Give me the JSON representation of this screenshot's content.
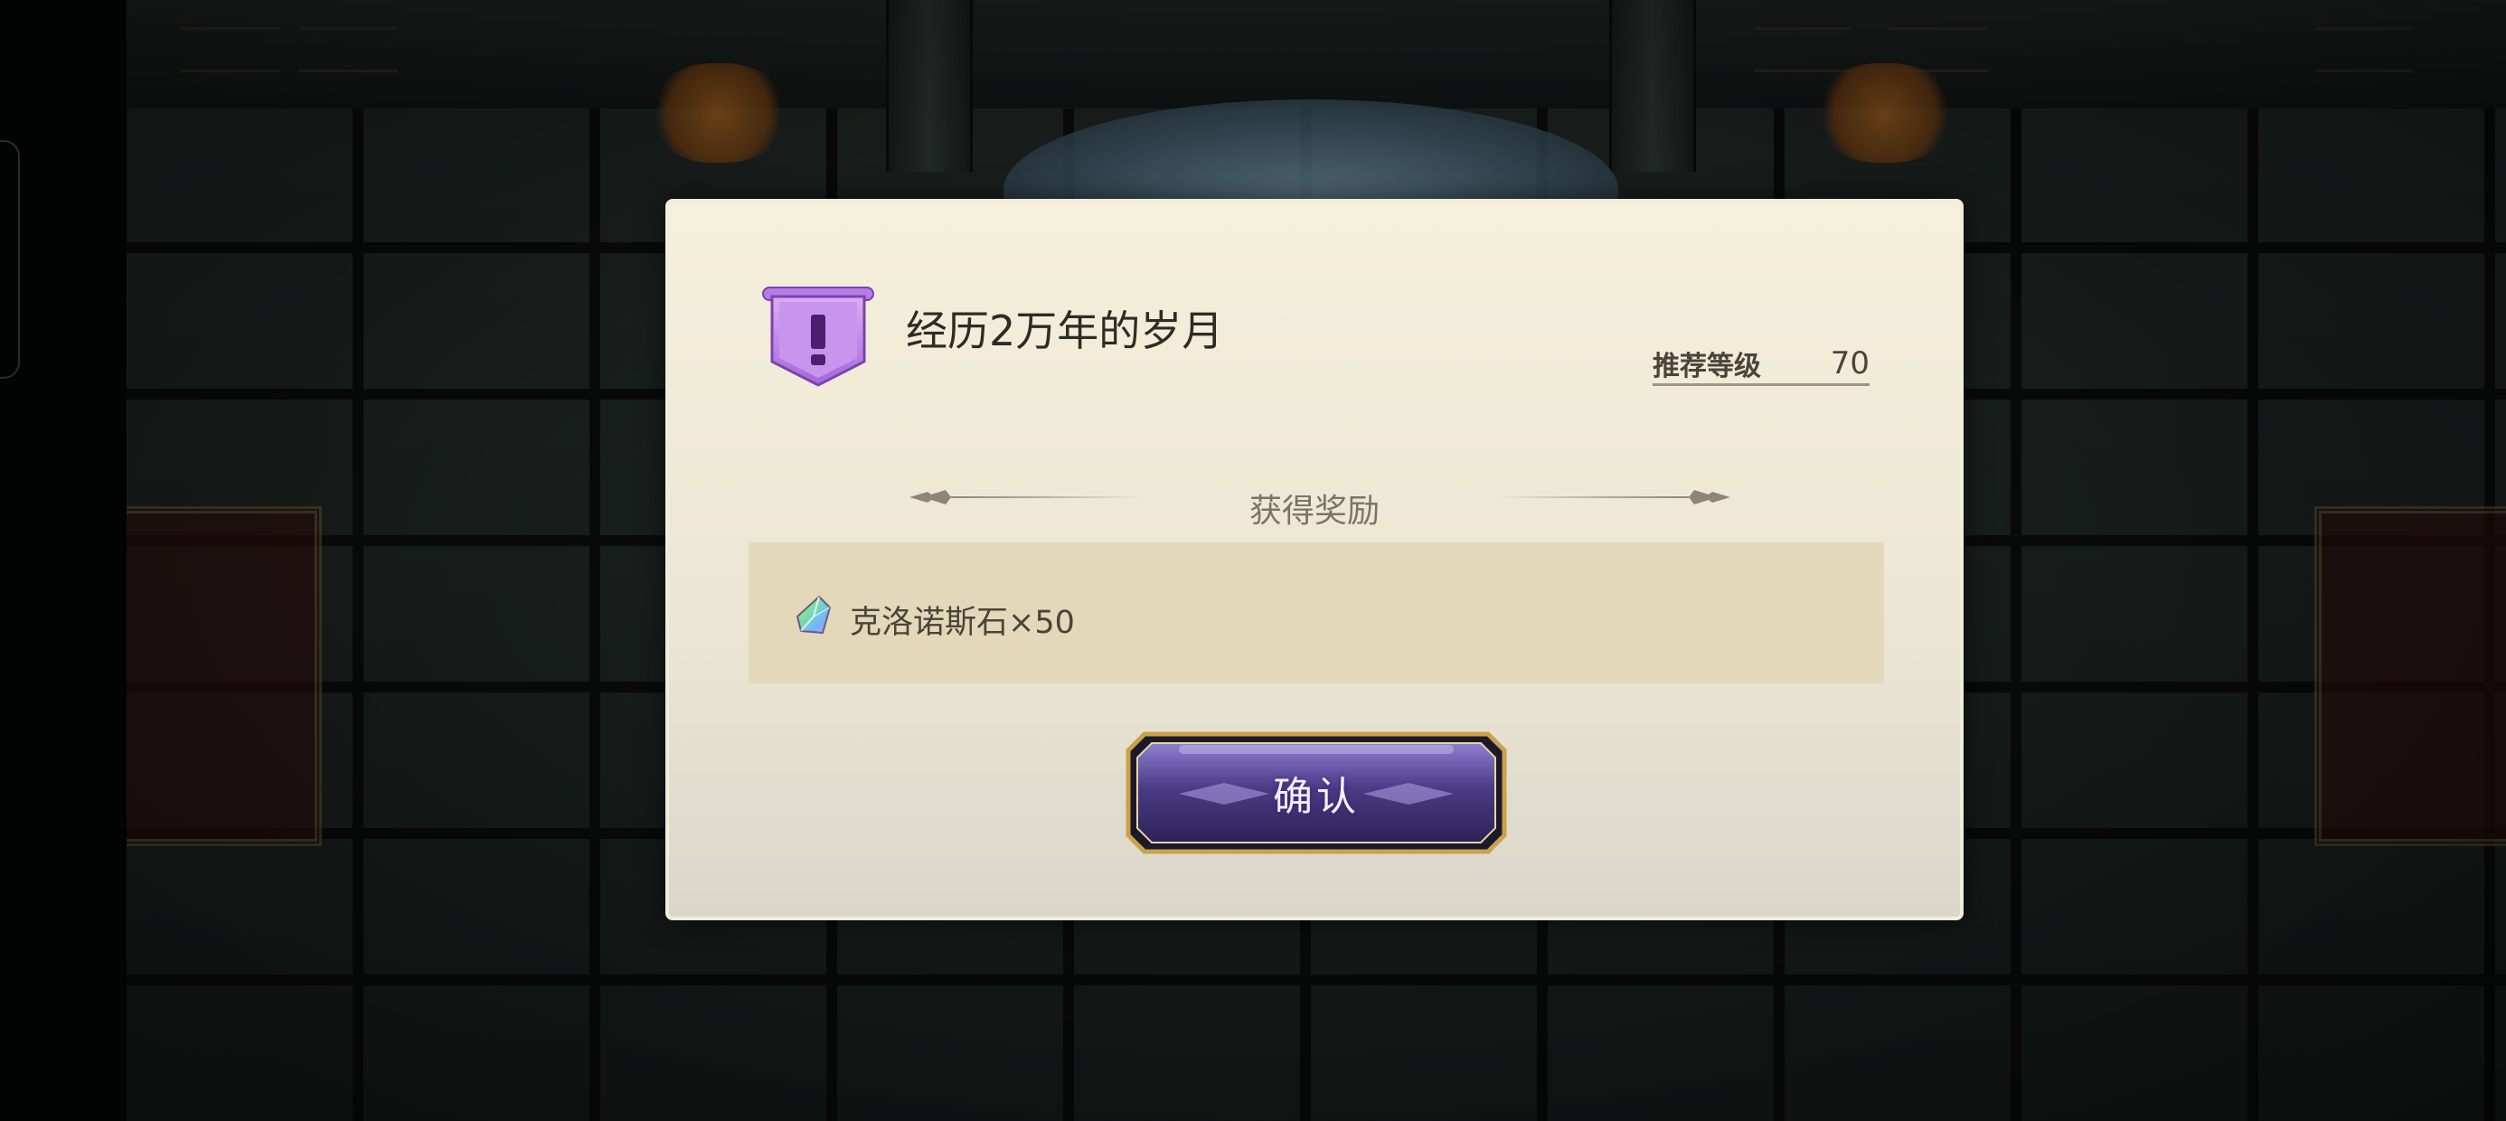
{
  "mission": {
    "title": "经历2万年的岁月",
    "badge_icon": "exclamation-banner-icon",
    "recommended_level_label": "推荐等级",
    "recommended_level_value": "70"
  },
  "rewards": {
    "heading": "获得奖励",
    "items": [
      {
        "icon": "chronos-stone-icon",
        "text": "克洛诺斯石×50"
      }
    ]
  },
  "actions": {
    "confirm_label": "确认"
  },
  "colors": {
    "dialog_bg": "#f5f0dc",
    "reward_box_bg": "#e3d8b9",
    "badge_purple": "#b67ee0",
    "button_purple": "#4a3c86",
    "button_gold": "#c9a24a"
  }
}
